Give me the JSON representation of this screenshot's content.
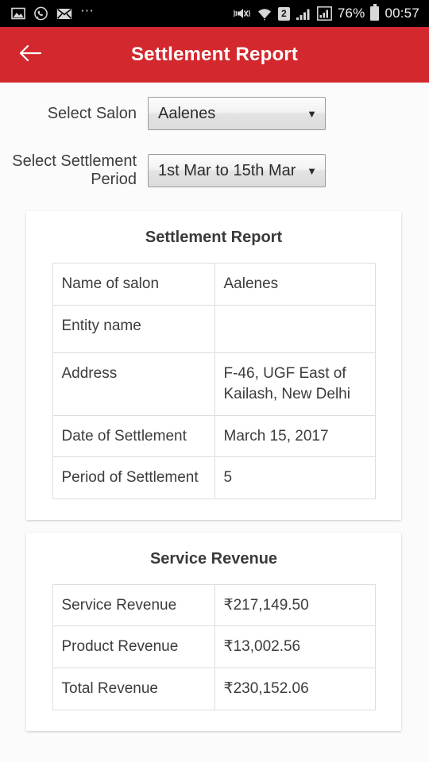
{
  "statusbar": {
    "left_icons": [
      "image-icon",
      "whatsapp-icon",
      "mail-icon",
      "overflow-dots-icon"
    ],
    "right_icons": [
      "vibrate-mute-icon",
      "wifi-icon",
      "sim2-icon",
      "signal-bars-icon",
      "signal-bars-alt-icon",
      "battery-icon"
    ],
    "sim_label": "2",
    "battery_percent": "76%",
    "clock": "00:57"
  },
  "appbar": {
    "back_icon": "arrow-left-icon",
    "title": "Settlement Report",
    "background": "#d2282e"
  },
  "form": {
    "salon": {
      "label": "Select Salon",
      "value": "Aalenes",
      "caret": "▼"
    },
    "period": {
      "label": "Select Settlement Period",
      "value": "1st Mar to 15th Mar",
      "caret": "▼"
    }
  },
  "cards": [
    {
      "title": "Settlement Report",
      "rows": [
        {
          "key": "Name of salon",
          "value": "Aalenes"
        },
        {
          "key": "Entity name",
          "value": ""
        },
        {
          "key": "Address",
          "value": "F-46, UGF East of Kailash, New Delhi"
        },
        {
          "key": "Date of Settlement",
          "value": "March 15, 2017"
        },
        {
          "key": "Period of Settlement",
          "value": "5"
        }
      ]
    },
    {
      "title": "Service Revenue",
      "rows": [
        {
          "key": "Service Revenue",
          "value": "₹217,149.50"
        },
        {
          "key": "Product Revenue",
          "value": "₹13,002.56"
        },
        {
          "key": "Total Revenue",
          "value": "₹230,152.06"
        }
      ]
    }
  ]
}
